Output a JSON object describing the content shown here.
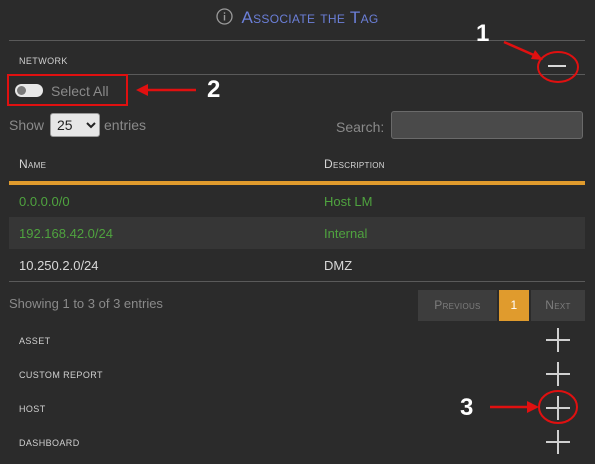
{
  "dialog": {
    "title": "Associate the Tag"
  },
  "network": {
    "label": "Network",
    "select_all": "Select All",
    "show_label": "Show",
    "entries_value": "25",
    "entries_label": "entries",
    "search_label": "Search:",
    "search_value": "",
    "columns": [
      "Name",
      "Description"
    ],
    "rows": [
      {
        "name": "0.0.0.0/0",
        "description": "Host LM",
        "selected": true
      },
      {
        "name": "192.168.42.0/24",
        "description": "Internal",
        "selected": true
      },
      {
        "name": "10.250.2.0/24",
        "description": "DMZ",
        "selected": false
      }
    ],
    "info": "Showing 1 to 3 of 3 entries",
    "pager": {
      "previous": "Previous",
      "page": "1",
      "next": "Next"
    }
  },
  "sections": [
    "Asset",
    "Custom Report",
    "Host",
    "Dashboard"
  ],
  "annotations": {
    "one": "1",
    "two": "2",
    "three": "3"
  },
  "colors": {
    "accent": "#e09b2d",
    "title": "#6b7fd8",
    "selected_text": "#4fa33f",
    "annotation": "#e01010"
  }
}
